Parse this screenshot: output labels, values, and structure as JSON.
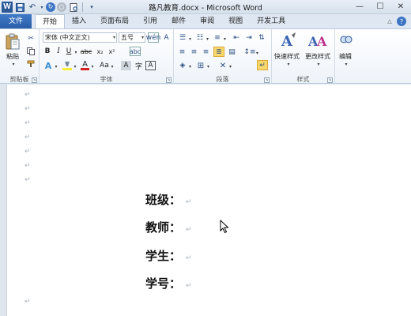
{
  "window": {
    "title": "路凡教育.docx - Microsoft Word"
  },
  "tabs": {
    "file": "文件",
    "items": [
      "开始",
      "插入",
      "页面布局",
      "引用",
      "邮件",
      "审阅",
      "视图",
      "开发工具"
    ]
  },
  "ribbon": {
    "clipboard": {
      "label": "剪贴板",
      "paste": "粘贴"
    },
    "font": {
      "label": "字体",
      "font_name": "宋体 (中文正文)",
      "font_size": "五号"
    },
    "paragraph": {
      "label": "段落"
    },
    "styles": {
      "label": "样式",
      "quick_styles": "快速样式",
      "change_styles": "更改样式"
    },
    "editing": {
      "label": "编辑"
    }
  },
  "document": {
    "fields": [
      "班级：",
      "教师：",
      "学生：",
      "学号："
    ],
    "paragraph_mark": "↵"
  }
}
